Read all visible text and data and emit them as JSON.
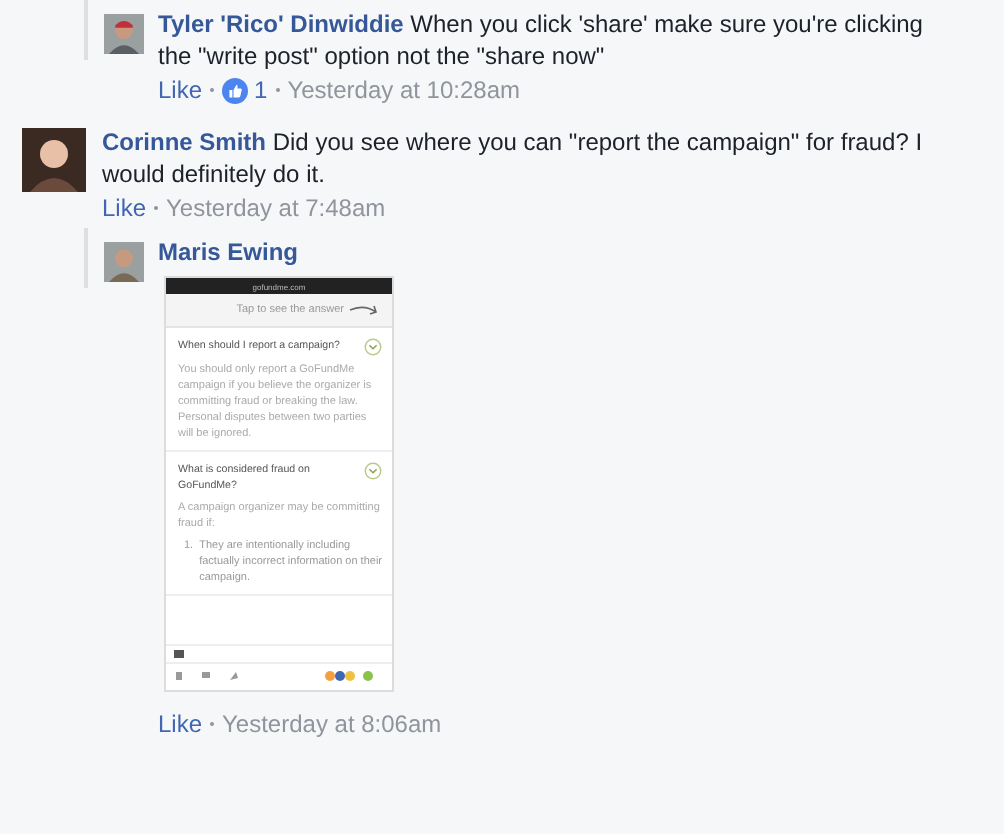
{
  "comments": [
    {
      "kind": "reply",
      "author": "Tyler 'Rico' Dinwiddie",
      "text": "When you click 'share' make sure you're clicking the \"write post\" option not the \"share now\"",
      "like": "Like",
      "likes": "1",
      "time": "Yesterday at 10:28am"
    },
    {
      "kind": "comment",
      "author": "Corinne Smith",
      "text": "Did you see where you can \"report the campaign\" for fraud? I would definitely do it.",
      "like": "Like",
      "time": "Yesterday at 7:48am"
    },
    {
      "kind": "reply",
      "author": "Maris Ewing",
      "like": "Like",
      "time": "Yesterday at 8:06am",
      "attachment": {
        "kind": "screenshot",
        "url": "gofundme.com",
        "hint": "Tap to see the answer",
        "faq": [
          {
            "question": "When should I report a campaign?",
            "expanded": true,
            "answer": "You should only report a GoFundMe campaign if you believe the organizer is committing fraud or breaking the law. Personal disputes between two parties will be ignored."
          },
          {
            "question": "What is considered fraud on GoFundMe?",
            "expanded": true,
            "answer": "A campaign organizer may be committing fraud if:",
            "list": [
              {
                "number": "1.",
                "text": "They are intentionally including factually incorrect information on their campaign."
              }
            ]
          }
        ]
      }
    }
  ]
}
